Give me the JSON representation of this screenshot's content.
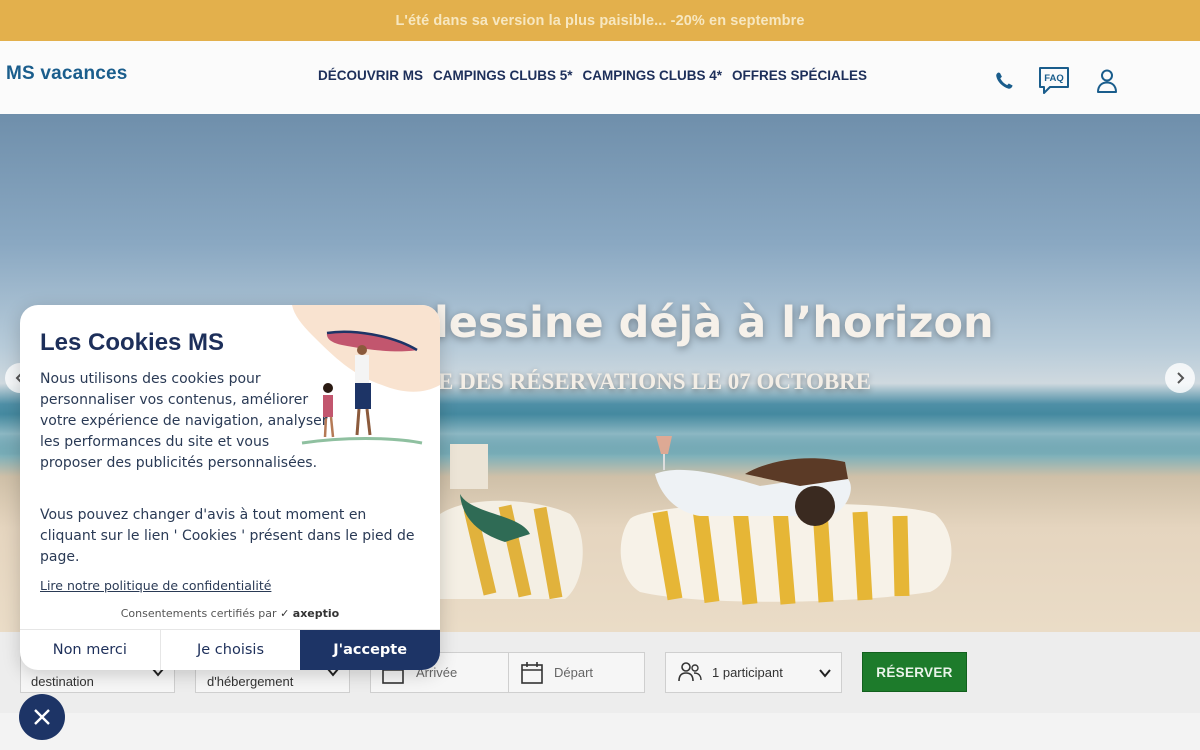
{
  "promo": {
    "text": "L'été dans sa version la plus paisible... -20% en septembre"
  },
  "header": {
    "logo": "MS vacances",
    "nav": [
      "DÉCOUVRIR MS",
      "CAMPINGS CLUBS 5*",
      "CAMPINGS CLUBS 4*",
      "OFFRES SPÉCIALES"
    ],
    "faq_label": "FAQ",
    "icons": [
      "phone-icon",
      "faq-chat-icon",
      "user-icon"
    ]
  },
  "hero": {
    "title": "dessine déjà à l’horizon",
    "subtitle": "E DES RÉSERVATIONS LE 07 OCTOBRE"
  },
  "search": {
    "destination": "destination",
    "accommodation": "d'hébergement",
    "arrival": "Arrivée",
    "departure": "Départ",
    "participants": "1 participant",
    "reserve": "RÉSERVER"
  },
  "cookie": {
    "title": "Les Cookies MS",
    "p1": "Nous utilisons des cookies pour personnaliser vos contenus, améliorer votre expérience de navigation, analyser les performances du site et vous proposer des publicités personnalisées.",
    "p2": "Vous pouvez changer d'avis à tout moment en cliquant sur le lien ' Cookies ' présent dans le pied de page.",
    "policy": "Lire notre politique de confidentialité",
    "certified": "Consentements certifiés par",
    "provider": "axeptio",
    "refuse": "Non merci",
    "choose": "Je choisis",
    "accept": "J'accepte"
  },
  "colors": {
    "promo_bg": "#e3b04c",
    "brand_navy": "#1d3466",
    "brand_blue": "#1a5d8c",
    "reserve_green": "#1d7b2b"
  }
}
